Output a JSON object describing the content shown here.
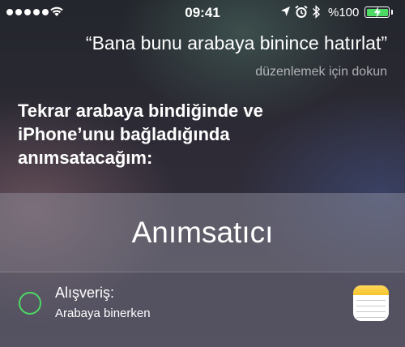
{
  "status_bar": {
    "time": "09:41",
    "battery_percent": "%100",
    "battery_level": 1.0,
    "signal_dots": 5,
    "icons": [
      "wifi-icon",
      "location-arrow-icon",
      "alarm-icon",
      "bluetooth-icon",
      "battery-icon",
      "charging-bolt-icon"
    ]
  },
  "siri": {
    "query": "“Bana bunu arabaya binince hatırlat”",
    "edit_hint": "düzenlemek için dokun",
    "response": "Tekrar arabaya bindiğinde ve iPhone’unu bağladığında anımsatacağım:"
  },
  "card": {
    "title": "Anımsatıcı",
    "item": {
      "title": "Alışveriş:",
      "subtitle": "Arabaya binerken"
    },
    "app_icon": "notes-app-icon"
  },
  "colors": {
    "accent_green": "#4cd964",
    "card_header_bg": "rgba(150,150,165,0.45)",
    "card_body_bg": "rgba(125,125,140,0.45)"
  }
}
